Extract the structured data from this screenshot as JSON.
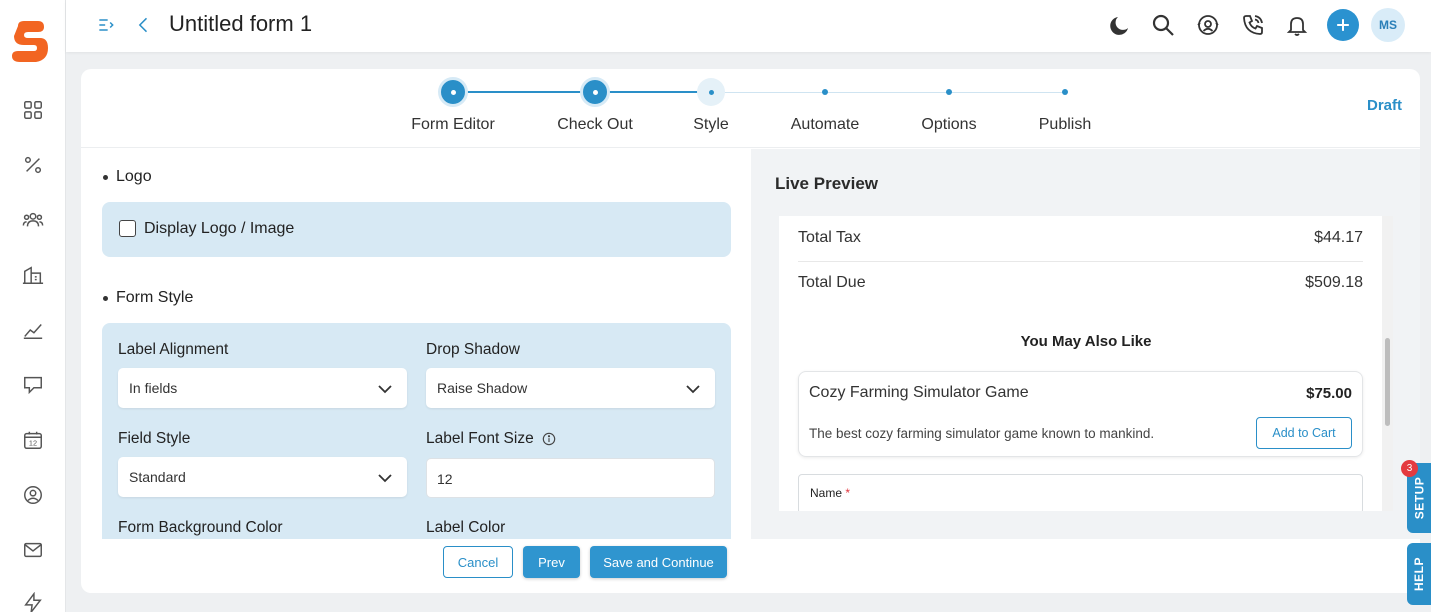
{
  "header": {
    "title": "Untitled form 1",
    "avatar_initials": "MS"
  },
  "stepper": {
    "steps": [
      {
        "label": "Form Editor",
        "state": "done"
      },
      {
        "label": "Check Out",
        "state": "done"
      },
      {
        "label": "Style",
        "state": "current"
      },
      {
        "label": "Automate",
        "state": "pending"
      },
      {
        "label": "Options",
        "state": "pending"
      },
      {
        "label": "Publish",
        "state": "pending"
      }
    ],
    "status": "Draft"
  },
  "logo_section": {
    "heading": "Logo",
    "checkbox_label": "Display Logo / Image",
    "checked": false
  },
  "form_style": {
    "heading": "Form Style",
    "label_alignment": {
      "label": "Label Alignment",
      "value": "In fields"
    },
    "drop_shadow": {
      "label": "Drop Shadow",
      "value": "Raise Shadow"
    },
    "field_style": {
      "label": "Field Style",
      "value": "Standard"
    },
    "label_font_size": {
      "label": "Label Font Size",
      "value": "12"
    },
    "form_background_color": {
      "label": "Form Background Color"
    },
    "label_color": {
      "label": "Label Color"
    }
  },
  "footer": {
    "cancel": "Cancel",
    "prev": "Prev",
    "save": "Save and Continue"
  },
  "live_preview": {
    "title": "Live Preview",
    "total_tax": {
      "label": "Total Tax",
      "value": "$44.17"
    },
    "total_due": {
      "label": "Total Due",
      "value": "$509.18"
    },
    "upsell_heading": "You May Also Like",
    "product": {
      "name": "Cozy Farming Simulator Game",
      "price": "$75.00",
      "description": "The best cozy farming simulator game known to mankind.",
      "button": "Add to Cart"
    },
    "name_field": {
      "label": "Name",
      "required_mark": "*"
    }
  },
  "side_tabs": {
    "setup": "SETUP",
    "setup_badge": "3",
    "help": "HELP"
  },
  "colors": {
    "accent": "#2a8fc8",
    "panel_blue": "#d7e9f4",
    "brand": "#f26522"
  },
  "icons": [
    "brand-logo-icon",
    "dashboard-icon",
    "percent-icon",
    "users-icon",
    "buildings-icon",
    "chart-icon",
    "feedback-icon",
    "calendar-icon",
    "contact-icon",
    "mail-icon",
    "bolt-icon",
    "menu-toggle-icon",
    "back-arrow-icon",
    "moon-icon",
    "search-icon",
    "support-icon",
    "phone-icon",
    "bell-icon",
    "plus-icon",
    "chevron-down-icon",
    "info-icon"
  ]
}
